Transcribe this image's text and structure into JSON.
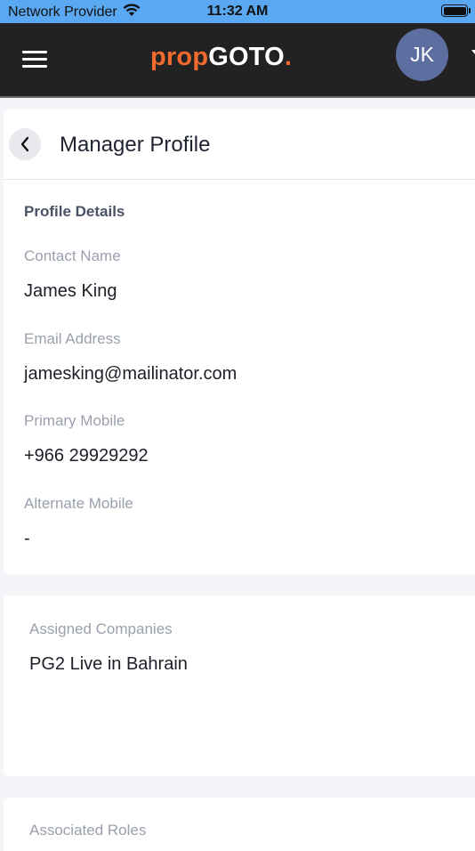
{
  "status_bar": {
    "carrier": "Network Provider",
    "time": "11:32 AM",
    "wifi_icon": "wifi-icon",
    "battery_icon": "battery-icon"
  },
  "header": {
    "menu_icon": "hamburger-menu-icon",
    "logo": {
      "prop": "prop",
      "goto": "GOTO",
      "dot": "."
    },
    "avatar_initials": "JK",
    "colors": {
      "header_bg": "#222222",
      "logo_orange": "#f26a2e",
      "avatar_bg": "#5d6fa1"
    }
  },
  "page": {
    "back_icon": "chevron-left-icon",
    "title": "Manager Profile"
  },
  "profile": {
    "heading": "Profile Details",
    "contact_name_label": "Contact Name",
    "contact_name": "James King",
    "email_label": "Email Address",
    "email": "jamesking@mailinator.com",
    "primary_mobile_label": "Primary Mobile",
    "primary_mobile": "+966 29929292",
    "alternate_mobile_label": "Alternate Mobile",
    "alternate_mobile": "-"
  },
  "companies": {
    "label": "Assigned Companies",
    "value": "PG2 Live in Bahrain"
  },
  "roles": {
    "label": "Associated Roles"
  }
}
